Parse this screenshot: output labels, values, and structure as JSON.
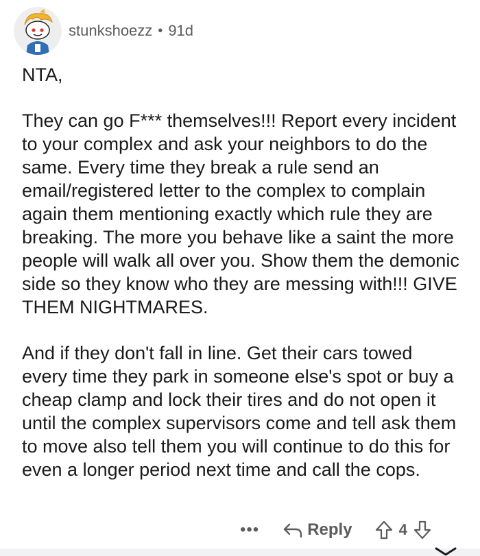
{
  "comment": {
    "username": "stunkshoezz",
    "separator": "•",
    "age": "91d",
    "paragraphs": [
      "NTA,",
      "They can go F*** themselves!!! Report every incident to your complex and ask your neighbors to do the same. Every time they break a rule send an email/registered letter to the complex to complain again them mentioning exactly which rule they are breaking. The more you behave like a saint the more people will walk all over you. Show them the demonic side so they know who they are messing with!!! GIVE THEM NIGHTMARES.",
      "And if they don't fall in line. Get their cars towed every time they park in someone else's spot or buy a cheap clamp and lock their tires and do not open it until the complex supervisors come and tell ask them to move also tell them you will continue to do this for even a longer period next time and call the cops."
    ]
  },
  "actions": {
    "more_icon": "more-dots-icon",
    "more_label": "•••",
    "reply_icon": "reply-arrow-icon",
    "reply_label": "Reply",
    "upvote_icon": "upvote-arrow-icon",
    "vote_count": "4",
    "downvote_icon": "downvote-arrow-icon"
  },
  "colors": {
    "text": "#1a1a1b",
    "meta": "#5c5c5e",
    "avatar_hair": "#f2b431",
    "avatar_jersey": "#2f6fb4"
  }
}
